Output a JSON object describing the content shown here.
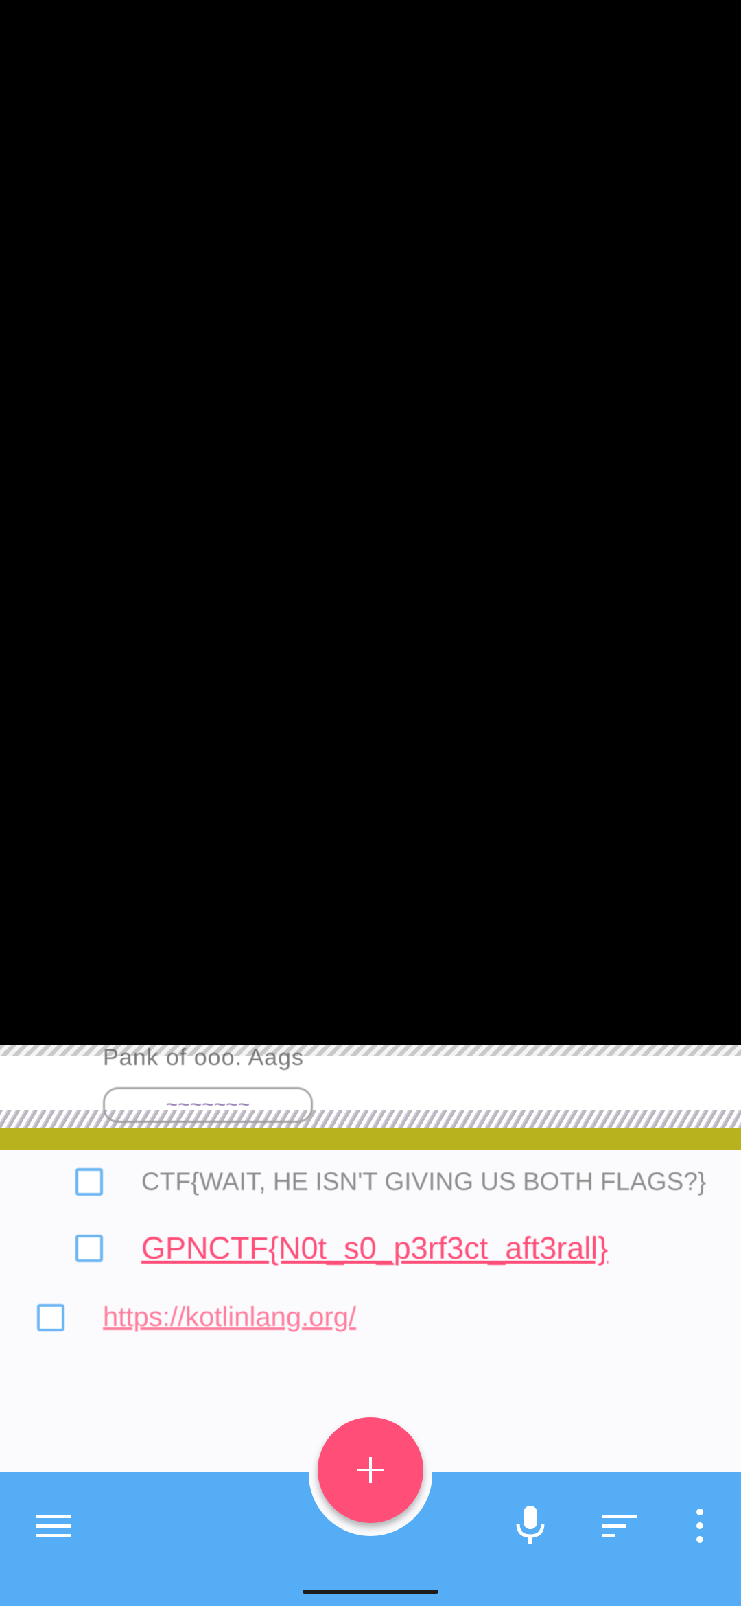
{
  "header_glitch": {
    "title_fragment": "Pank of ooo. Aags",
    "button_fragment": "~~~~~~~"
  },
  "todo": {
    "items": [
      {
        "text": "CTF{WAIT, HE ISN'T GIVING US BOTH FLAGS?}",
        "checked": false,
        "style": "muted"
      },
      {
        "text": "GPNCTF{N0t_s0_p3rf3ct_aft3rall}",
        "checked": false,
        "style": "link"
      },
      {
        "text": "https://kotlinlang.org/",
        "checked": false,
        "style": "link"
      }
    ]
  },
  "fab": {
    "icon": "plus-icon",
    "label": "+"
  },
  "bottom_bar": {
    "icons": [
      "menu-icon",
      "mic-icon",
      "sort-icon",
      "more-vert-icon"
    ]
  },
  "colors": {
    "accent": "#ff4f79",
    "bar": "#55adf6",
    "checkbox": "#6cb6f4",
    "background": "#fbfbfe"
  }
}
